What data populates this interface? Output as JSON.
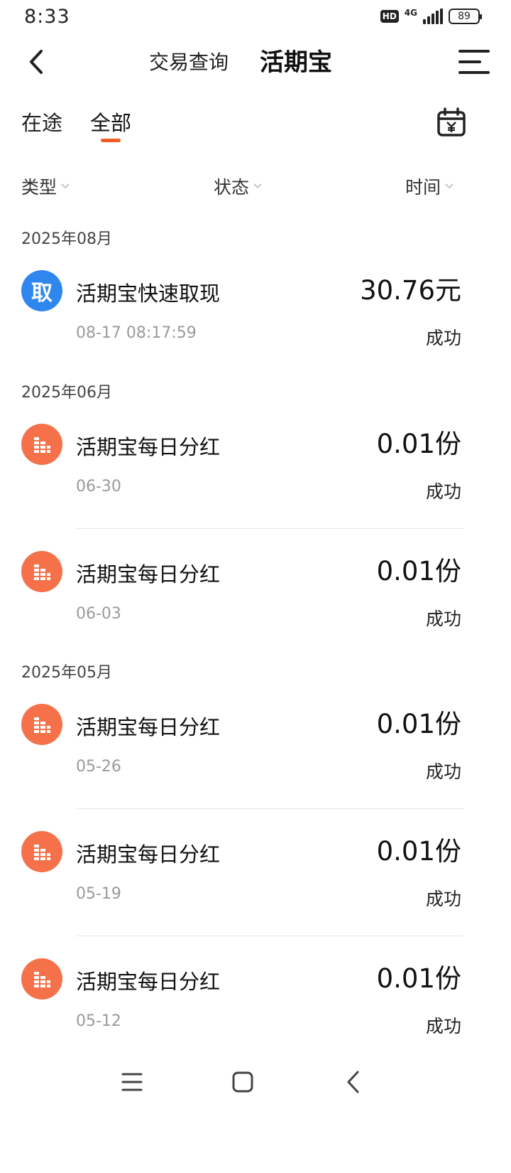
{
  "status_bar": {
    "time": "8:33",
    "hd": "HD",
    "network": "4G",
    "battery": "89"
  },
  "nav": {
    "tab_query": "交易查询",
    "tab_huoqi": "活期宝"
  },
  "subtabs": {
    "in_transit": "在途",
    "all": "全部"
  },
  "filters": {
    "type": "类型",
    "status": "状态",
    "time": "时间"
  },
  "months": [
    "2025年08月",
    "2025年06月",
    "2025年05月"
  ],
  "transactions": [
    {
      "icon": "withdraw-icon",
      "icon_char": "取",
      "title": "活期宝快速取现",
      "date": "08-17 08:17:59",
      "amount": "30.76元",
      "status": "成功"
    },
    {
      "icon": "dividend-icon",
      "title": "活期宝每日分红",
      "date": "06-30",
      "amount": "0.01份",
      "status": "成功"
    },
    {
      "icon": "dividend-icon",
      "title": "活期宝每日分红",
      "date": "06-03",
      "amount": "0.01份",
      "status": "成功"
    },
    {
      "icon": "dividend-icon",
      "title": "活期宝每日分红",
      "date": "05-26",
      "amount": "0.01份",
      "status": "成功"
    },
    {
      "icon": "dividend-icon",
      "title": "活期宝每日分红",
      "date": "05-19",
      "amount": "0.01份",
      "status": "成功"
    },
    {
      "icon": "dividend-icon",
      "title": "活期宝每日分红",
      "date": "05-12",
      "amount": "0.01份",
      "status": "成功"
    }
  ],
  "colors": {
    "accent": "#f05a24",
    "withdraw_icon_bg": "#2f87ee",
    "dividend_icon_bg": "#f5714a"
  }
}
